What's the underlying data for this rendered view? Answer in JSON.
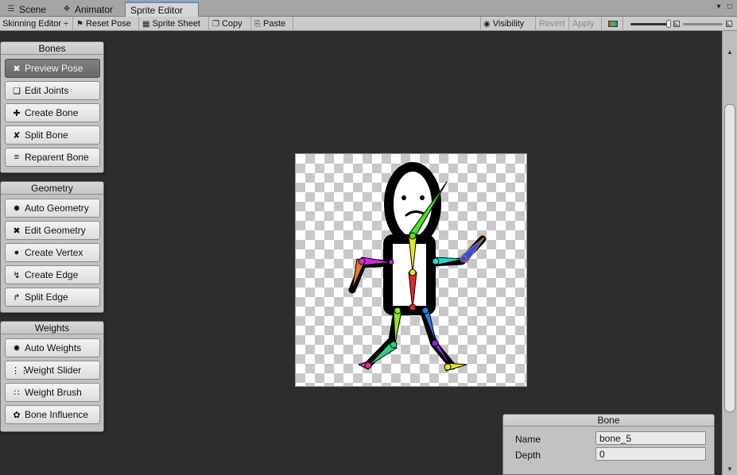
{
  "tabs": [
    {
      "label": "Scene",
      "icon": "scene-icon"
    },
    {
      "label": "Animator",
      "icon": "animator-icon"
    },
    {
      "label": "Sprite Editor",
      "icon": ""
    }
  ],
  "toolbar": {
    "mode": "Skinning Editor ÷",
    "reset_pose": "Reset Pose",
    "sprite_sheet": "Sprite Sheet",
    "copy": "Copy",
    "paste": "Paste",
    "visibility": "Visibility",
    "revert": "Revert",
    "apply": "Apply"
  },
  "panels": {
    "bones": {
      "title": "Bones",
      "items": [
        "Preview Pose",
        "Edit Joints",
        "Create Bone",
        "Split Bone",
        "Reparent Bone"
      ]
    },
    "geometry": {
      "title": "Geometry",
      "items": [
        "Auto Geometry",
        "Edit Geometry",
        "Create Vertex",
        "Create Edge",
        "Split Edge"
      ]
    },
    "weights": {
      "title": "Weights",
      "items": [
        "Auto Weights",
        "Weight Slider",
        "Weight Brush",
        "Bone Influence"
      ]
    }
  },
  "bone_inspector": {
    "title": "Bone",
    "name_label": "Name",
    "name_value": "bone_5",
    "depth_label": "Depth",
    "depth_value": "0"
  },
  "colors": {
    "active_tab_accent": "#5b8fd9",
    "active_tool": "#737373",
    "canvas_bg": "#2d2d2d"
  }
}
